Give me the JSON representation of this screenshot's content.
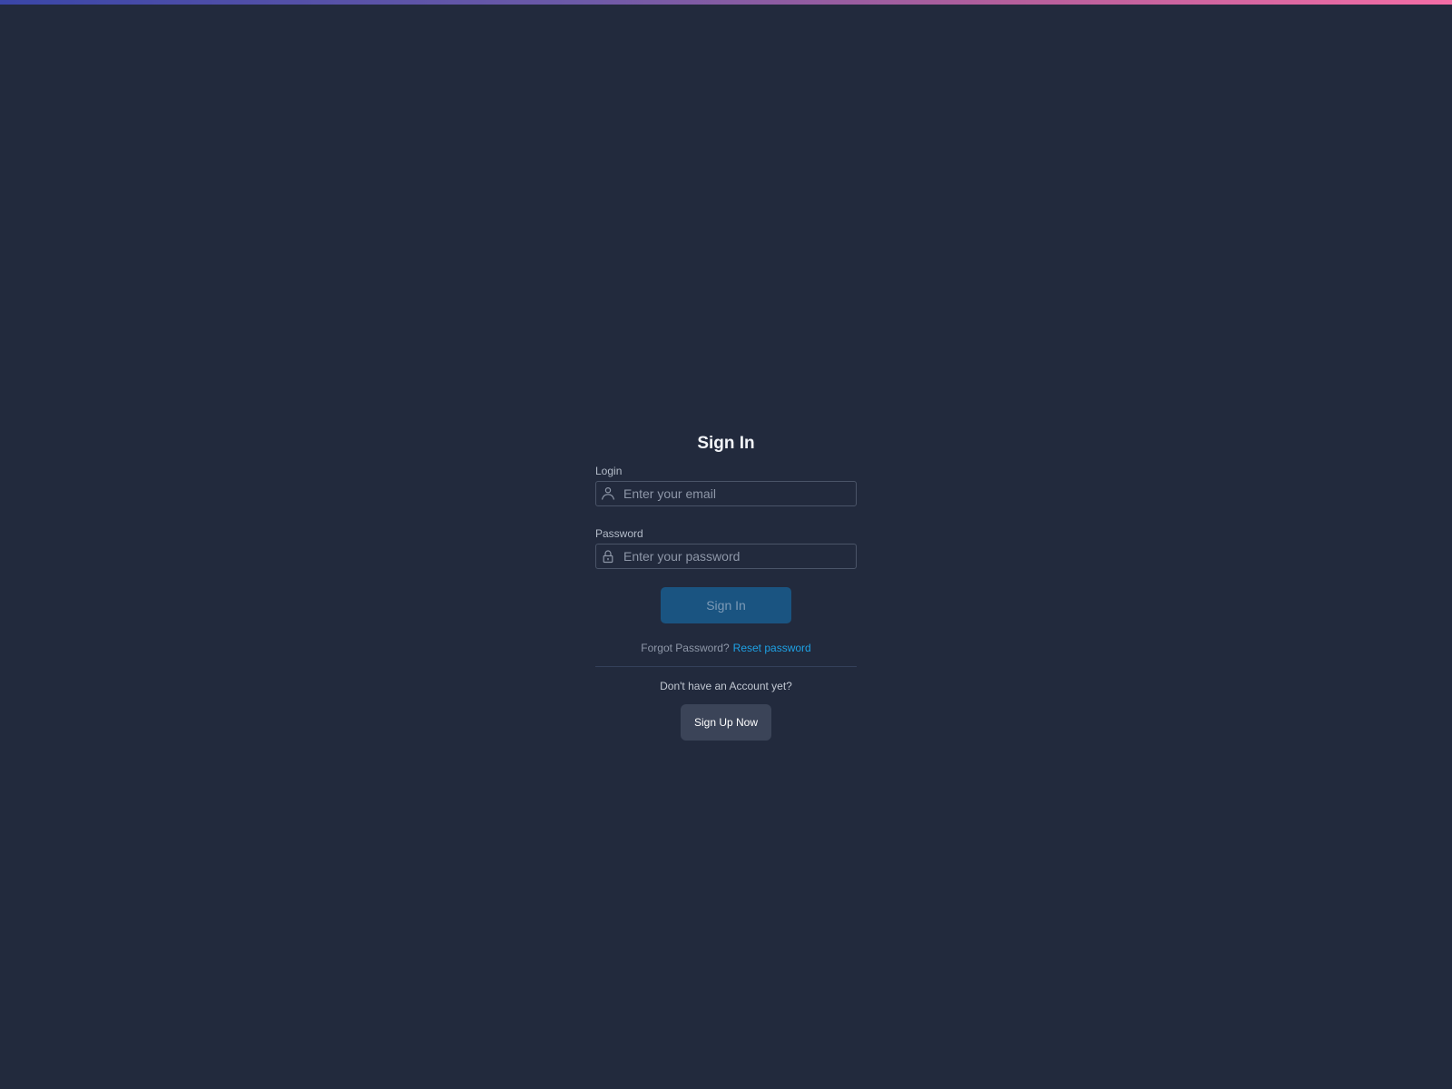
{
  "signin_form": {
    "title": "Sign In",
    "login": {
      "label": "Login",
      "placeholder": "Enter your email",
      "value": "",
      "icon": "user-icon"
    },
    "password": {
      "label": "Password",
      "placeholder": "Enter your password",
      "value": "",
      "icon": "lock-icon"
    },
    "submit_label": "Sign In",
    "forgot_text": "Forgot Password?",
    "reset_link": "Reset password",
    "no_account_text": "Don't have an Account yet?",
    "signup_label": "Sign Up Now"
  },
  "colors": {
    "background": "#222a3d",
    "primary_button": "#1a5481",
    "link": "#1ea1e4",
    "secondary_button": "#3b4458",
    "top_gradient_start": "#3a46a8",
    "top_gradient_end": "#f46da6"
  }
}
